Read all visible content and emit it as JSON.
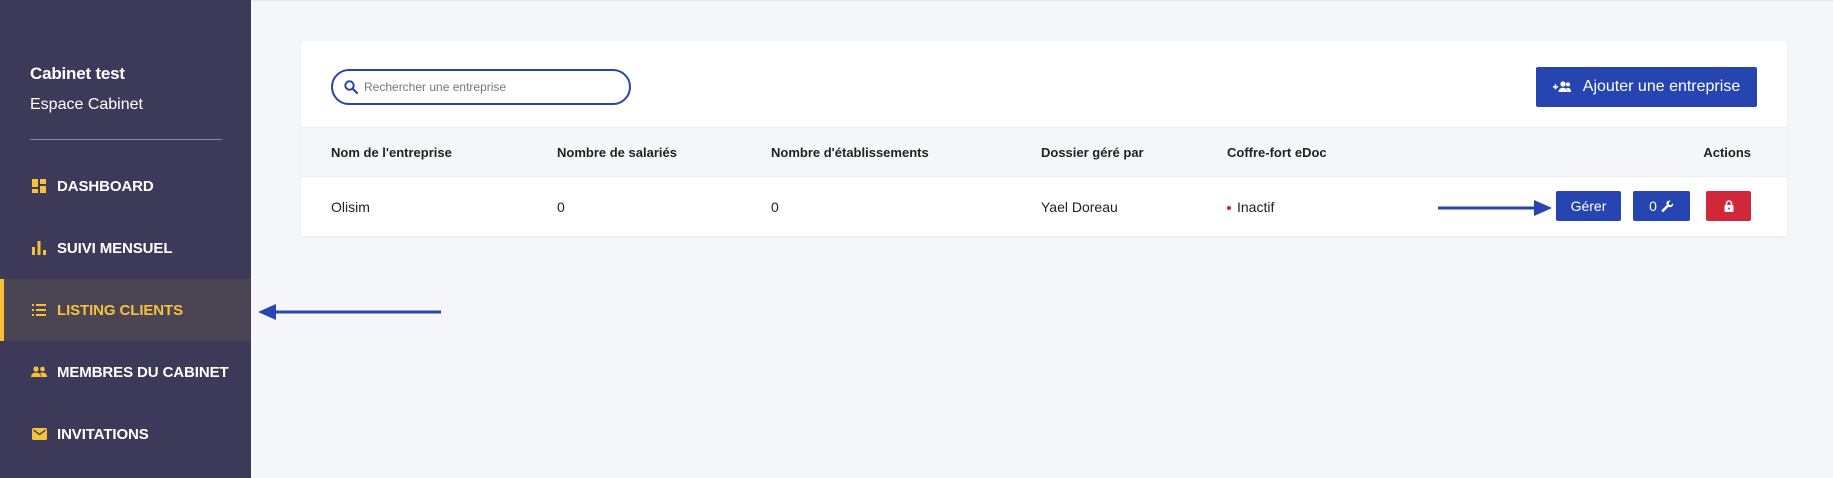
{
  "sidebar": {
    "brand_name": "Cabinet test",
    "brand_sub": "Espace Cabinet",
    "items": [
      {
        "label": "DASHBOARD",
        "icon": "dashboard-icon"
      },
      {
        "label": "SUIVI MENSUEL",
        "icon": "bar-chart-icon"
      },
      {
        "label": "LISTING CLIENTS",
        "icon": "list-icon",
        "active": true
      },
      {
        "label": "MEMBRES DU CABINET",
        "icon": "people-icon"
      },
      {
        "label": "INVITATIONS",
        "icon": "mail-icon"
      }
    ]
  },
  "toolbar": {
    "search_placeholder": "Rechercher une entreprise",
    "add_label": "Ajouter une entreprise"
  },
  "table": {
    "headers": [
      "Nom de l'entreprise",
      "Nombre de salariés",
      "Nombre d'établissements",
      "Dossier géré par",
      "Coffre-fort eDoc",
      "Actions"
    ],
    "rows": [
      {
        "name": "Olisim",
        "employees": "0",
        "establishments": "0",
        "manager": "Yael Doreau",
        "status": "Inactif",
        "manage_label": "Gérer",
        "tool_count": "0"
      }
    ]
  },
  "colors": {
    "sidebar_bg": "#3d3a59",
    "accent_yellow": "#f7c23a",
    "primary_blue": "#2645b0",
    "danger_red": "#d0283a"
  }
}
